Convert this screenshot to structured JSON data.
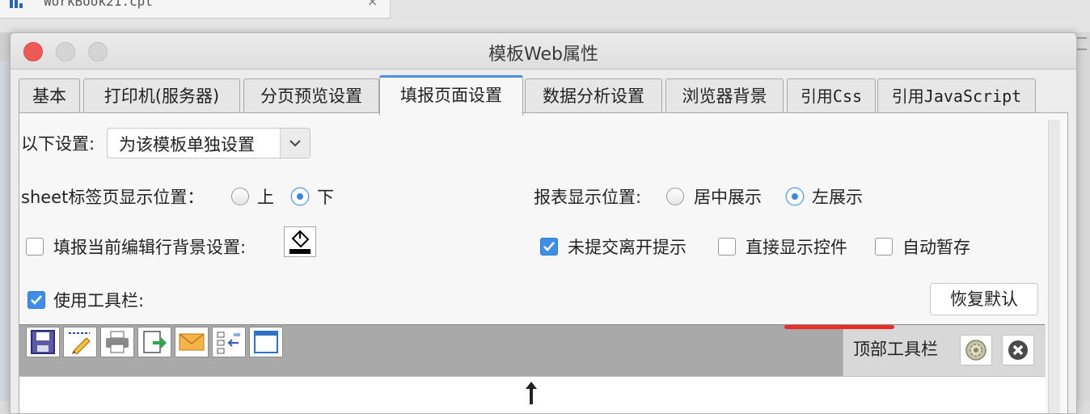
{
  "background_app": {
    "file_tab": "WorkBook21.cpt",
    "close_symbol": "×"
  },
  "dialog": {
    "title": "模板Web属性",
    "tabs": [
      {
        "label": "基本"
      },
      {
        "label": "打印机(服务器)"
      },
      {
        "label": "分页预览设置"
      },
      {
        "label": "填报页面设置"
      },
      {
        "label": "数据分析设置"
      },
      {
        "label": "浏览器背景"
      },
      {
        "label": "引用Css"
      },
      {
        "label": "引用JavaScript"
      }
    ],
    "active_tab": "填报页面设置"
  },
  "settings": {
    "scope_label": "以下设置:",
    "scope_value": "为该模板单独设置",
    "sheet_tab_label": "sheet标签页显示位置：",
    "sheet_tab_options": [
      "上",
      "下"
    ],
    "sheet_tab_selected": "下",
    "report_pos_label": "报表显示位置:",
    "report_pos_options": [
      "居中展示",
      "左展示"
    ],
    "report_pos_selected": "左展示",
    "row_bg_label": "填报当前编辑行背景设置:",
    "row_bg_checked": false,
    "leave_prompt_label": "未提交离开提示",
    "leave_prompt_checked": true,
    "direct_widget_label": "直接显示控件",
    "direct_widget_checked": false,
    "auto_save_label": "自动暂存",
    "auto_save_checked": false,
    "use_toolbar_label": "使用工具栏:",
    "use_toolbar_checked": true,
    "restore_default_label": "恢复默认"
  },
  "toolbar": {
    "position_label": "顶部工具栏",
    "icons": [
      "save-icon",
      "edit-icon",
      "print-icon",
      "export-icon",
      "email-icon",
      "insert-row-icon",
      "window-icon"
    ]
  },
  "colors": {
    "accent": "#3e8ee8",
    "annotation_red": "#ee2a25",
    "toolbar_gray": "#a9a9a9"
  }
}
